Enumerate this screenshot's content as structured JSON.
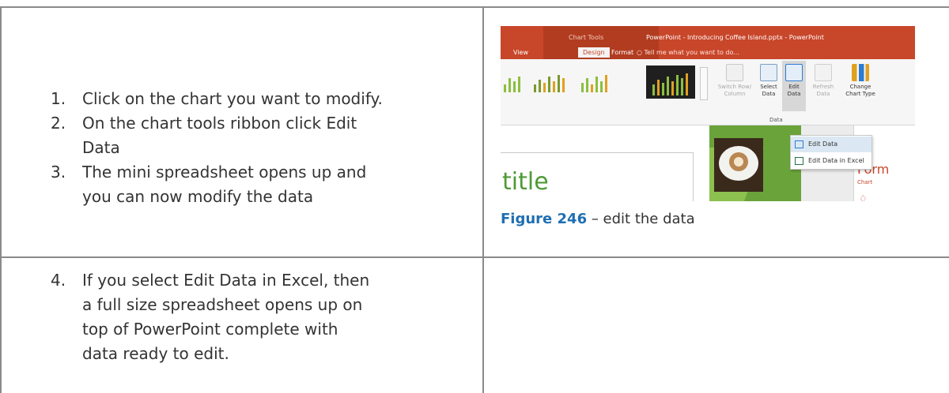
{
  "steps_top": [
    {
      "num": "1.",
      "lines": [
        "Click on the chart you want to modify."
      ]
    },
    {
      "num": "2.",
      "lines": [
        "On the chart tools ribbon click Edit",
        "Data"
      ]
    },
    {
      "num": "3.",
      "lines": [
        "The mini spreadsheet opens up and",
        "you can now modify the data"
      ]
    }
  ],
  "steps_bottom": [
    {
      "num": "4.",
      "lines": [
        "If you select Edit Data in Excel, then",
        "a full size spreadsheet opens up on",
        "top of PowerPoint complete with",
        "data ready to edit."
      ]
    }
  ],
  "screenshot": {
    "contextual_tab": "Chart Tools",
    "window_title": "PowerPoint - Introducing Coffee Island.pptx - PowerPoint",
    "tabs": [
      "View",
      "Design",
      "Format"
    ],
    "active_tab": "Design",
    "tell_me": "Tell me what you want to do...",
    "buttons": {
      "switch_row_column": "Switch Row/ Column",
      "select_data": "Select Data",
      "edit_data": "Edit Data",
      "refresh_data": "Refresh Data",
      "change_chart_type": "Change Chart Type"
    },
    "group_label": "Data",
    "dropdown": [
      "Edit Data",
      "Edit Data in Excel"
    ],
    "slide_title": "title",
    "format_pane_title": "Form",
    "format_pane_sub": "Chart"
  },
  "caption": {
    "label": "Figure 246",
    "text": " – edit the data"
  },
  "colors": {
    "accent_red": "#c8462a",
    "accent_green": "#4e9a35",
    "caption_blue": "#1f6fb2"
  }
}
